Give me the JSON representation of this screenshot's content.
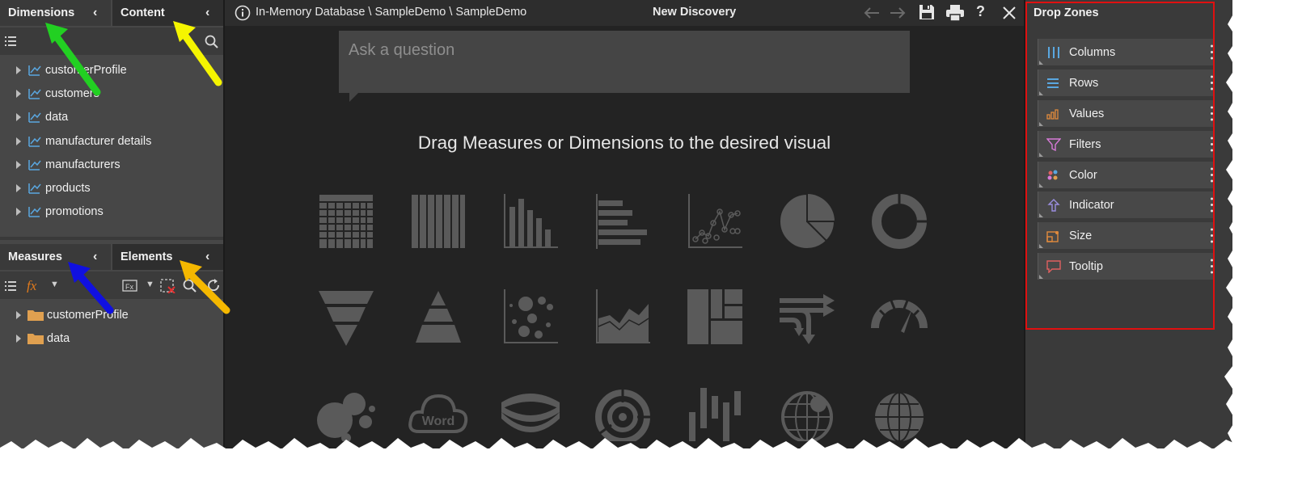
{
  "left_panel": {
    "top_tabs": {
      "dimensions": "Dimensions",
      "content": "Content"
    },
    "dimensions_tree": [
      {
        "label": "customerProfile"
      },
      {
        "label": "customers"
      },
      {
        "label": "data"
      },
      {
        "label": "manufacturer details"
      },
      {
        "label": "manufacturers"
      },
      {
        "label": "products"
      },
      {
        "label": "promotions"
      }
    ],
    "bottom_tabs": {
      "measures": "Measures",
      "elements": "Elements"
    },
    "measures_tree": [
      {
        "label": "customerProfile"
      },
      {
        "label": "data"
      }
    ]
  },
  "main": {
    "breadcrumb": "In-Memory Database \\ SampleDemo \\ SampleDemo",
    "title": "New Discovery",
    "ask_placeholder": "Ask a question",
    "hint": "Drag Measures or Dimensions to the desired visual",
    "visuals_row3_word_label": "Word"
  },
  "drop_zones": {
    "title": "Drop Zones",
    "items": [
      {
        "label": "Columns",
        "icon": "columns-icon",
        "color": "#5aa7e0"
      },
      {
        "label": "Rows",
        "icon": "rows-icon",
        "color": "#5aa7e0"
      },
      {
        "label": "Values",
        "icon": "values-icon",
        "color": "#e08a3c"
      },
      {
        "label": "Filters",
        "icon": "filter-icon",
        "color": "#d77ad8"
      },
      {
        "label": "Color",
        "icon": "color-icon",
        "color": "#e06060"
      },
      {
        "label": "Indicator",
        "icon": "indicator-icon",
        "color": "#9a8ee0"
      },
      {
        "label": "Size",
        "icon": "size-icon",
        "color": "#e08a3c"
      },
      {
        "label": "Tooltip",
        "icon": "tooltip-icon",
        "color": "#e06060"
      }
    ]
  },
  "colors": {
    "accent_red": "#e01010",
    "arrow_green": "#22d022",
    "arrow_yellow": "#f5f500",
    "arrow_blue": "#1010e0",
    "arrow_orange": "#f5b800"
  }
}
